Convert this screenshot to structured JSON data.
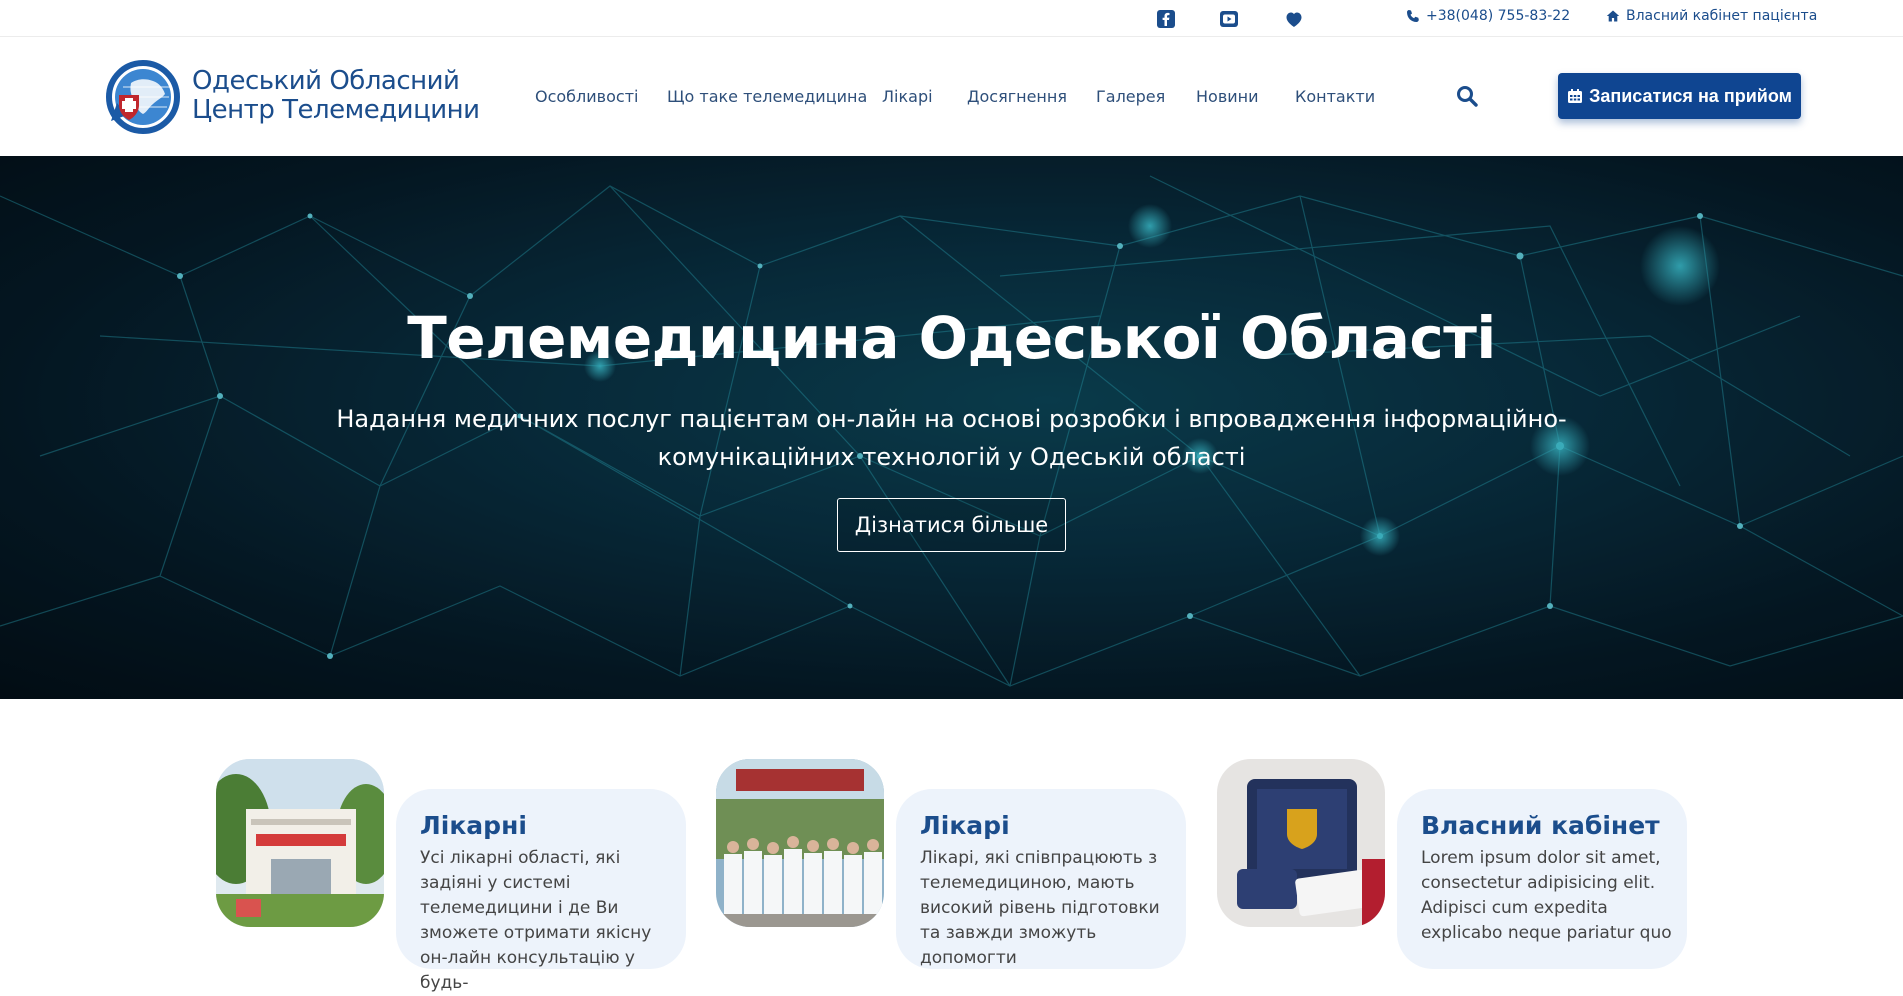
{
  "topbar": {
    "icons": [
      "facebook-icon",
      "youtube-icon",
      "heart-icon"
    ],
    "phone": "+38(048) 755-83-22",
    "cabinet": "Власний кабінет пацієнта"
  },
  "header": {
    "logo_line1": "Одеський Обласний",
    "logo_line2": "Центр Телемедицини",
    "nav": [
      {
        "label": "Особливості"
      },
      {
        "label": "Що таке телемедицина"
      },
      {
        "label": "Лікарі"
      },
      {
        "label": "Досягнення"
      },
      {
        "label": "Галерея"
      },
      {
        "label": "Новини"
      },
      {
        "label": "Контакти"
      }
    ],
    "cta_label": "Записатися на прийом"
  },
  "hero": {
    "title": "Телемедицина Одеської Області",
    "subtitle": "Надання медичних послуг пацієнтам он-лайн на основі розробки і впровадження інформаційно-комунікаційних технологій у Одеській області",
    "button": "Дізнатися більше"
  },
  "cards": [
    {
      "title": "Лікарні",
      "text": "Усі лікарні області, які задіяні у системі телемедицини і де Ви зможете отримати якісну он-лайн консультацію у будь-"
    },
    {
      "title": "Лікарі",
      "text": "Лікарі, які співпрацюють з телемедициною, мають високий рівень підготовки та завжди зможуть допомогти"
    },
    {
      "title": "Власний кабінет",
      "text": "Lorem ipsum dolor sit amet, consectetur adipisicing elit. Adipisci cum expedita explicabo neque pariatur quo"
    }
  ],
  "colors": {
    "brand": "#1b4d8c",
    "cta": "#0f4591",
    "card_bg": "#edf3fb"
  }
}
